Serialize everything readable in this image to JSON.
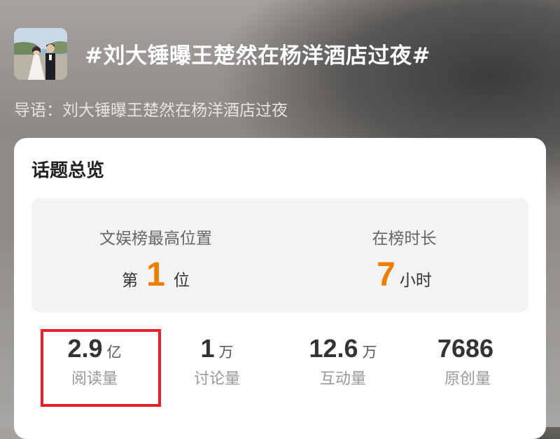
{
  "header": {
    "title": "#刘大锤曝王楚然在杨洋酒店过夜#",
    "intro": "导语：刘大锤曝王楚然在杨洋酒店过夜"
  },
  "overview": {
    "title": "话题总览",
    "rank": {
      "highest_label": "文娱榜最高位置",
      "highest_prefix": "第",
      "highest_value": "1",
      "highest_suffix": "位",
      "duration_label": "在榜时长",
      "duration_value": "7",
      "duration_unit": "小时"
    },
    "stats": [
      {
        "value": "2.9",
        "unit": "亿",
        "label": "阅读量"
      },
      {
        "value": "1",
        "unit": "万",
        "label": "讨论量"
      },
      {
        "value": "12.6",
        "unit": "万",
        "label": "互动量"
      },
      {
        "value": "7686",
        "unit": "",
        "label": "原创量"
      }
    ]
  },
  "colors": {
    "accent_orange": "#f07d00",
    "highlight_red": "#e8202a"
  }
}
